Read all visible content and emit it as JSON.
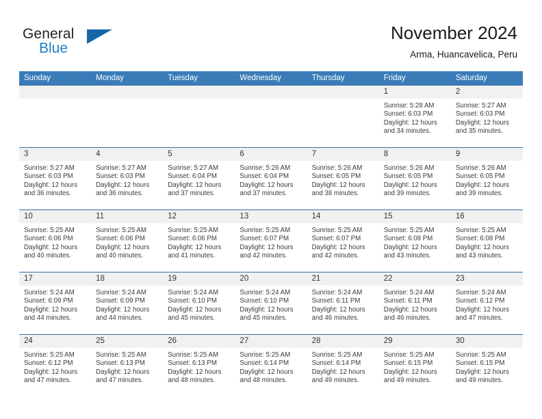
{
  "brand": {
    "name_part1": "General",
    "name_part2": "Blue",
    "flag_icon": "triangle-flag-icon"
  },
  "header": {
    "month_title": "November 2024",
    "location": "Arma, Huancavelica, Peru"
  },
  "colors": {
    "header_blue": "#3a7cb8",
    "row_border_blue": "#2f6fa8",
    "daynum_band": "#f1f1f1",
    "brand_blue": "#1f7fc4",
    "flag_blue": "#1565a8",
    "text": "#3a3a3a"
  },
  "weekday_headers": [
    "Sunday",
    "Monday",
    "Tuesday",
    "Wednesday",
    "Thursday",
    "Friday",
    "Saturday"
  ],
  "weeks": [
    [
      {
        "day": "",
        "empty": true
      },
      {
        "day": "",
        "empty": true
      },
      {
        "day": "",
        "empty": true
      },
      {
        "day": "",
        "empty": true
      },
      {
        "day": "",
        "empty": true
      },
      {
        "day": "1",
        "sunrise": "Sunrise: 5:28 AM",
        "sunset": "Sunset: 6:03 PM",
        "daylight1": "Daylight: 12 hours",
        "daylight2": "and 34 minutes."
      },
      {
        "day": "2",
        "sunrise": "Sunrise: 5:27 AM",
        "sunset": "Sunset: 6:03 PM",
        "daylight1": "Daylight: 12 hours",
        "daylight2": "and 35 minutes."
      }
    ],
    [
      {
        "day": "3",
        "sunrise": "Sunrise: 5:27 AM",
        "sunset": "Sunset: 6:03 PM",
        "daylight1": "Daylight: 12 hours",
        "daylight2": "and 36 minutes."
      },
      {
        "day": "4",
        "sunrise": "Sunrise: 5:27 AM",
        "sunset": "Sunset: 6:03 PM",
        "daylight1": "Daylight: 12 hours",
        "daylight2": "and 36 minutes."
      },
      {
        "day": "5",
        "sunrise": "Sunrise: 5:27 AM",
        "sunset": "Sunset: 6:04 PM",
        "daylight1": "Daylight: 12 hours",
        "daylight2": "and 37 minutes."
      },
      {
        "day": "6",
        "sunrise": "Sunrise: 5:26 AM",
        "sunset": "Sunset: 6:04 PM",
        "daylight1": "Daylight: 12 hours",
        "daylight2": "and 37 minutes."
      },
      {
        "day": "7",
        "sunrise": "Sunrise: 5:26 AM",
        "sunset": "Sunset: 6:05 PM",
        "daylight1": "Daylight: 12 hours",
        "daylight2": "and 38 minutes."
      },
      {
        "day": "8",
        "sunrise": "Sunrise: 5:26 AM",
        "sunset": "Sunset: 6:05 PM",
        "daylight1": "Daylight: 12 hours",
        "daylight2": "and 39 minutes."
      },
      {
        "day": "9",
        "sunrise": "Sunrise: 5:26 AM",
        "sunset": "Sunset: 6:05 PM",
        "daylight1": "Daylight: 12 hours",
        "daylight2": "and 39 minutes."
      }
    ],
    [
      {
        "day": "10",
        "sunrise": "Sunrise: 5:25 AM",
        "sunset": "Sunset: 6:06 PM",
        "daylight1": "Daylight: 12 hours",
        "daylight2": "and 40 minutes."
      },
      {
        "day": "11",
        "sunrise": "Sunrise: 5:25 AM",
        "sunset": "Sunset: 6:06 PM",
        "daylight1": "Daylight: 12 hours",
        "daylight2": "and 40 minutes."
      },
      {
        "day": "12",
        "sunrise": "Sunrise: 5:25 AM",
        "sunset": "Sunset: 6:06 PM",
        "daylight1": "Daylight: 12 hours",
        "daylight2": "and 41 minutes."
      },
      {
        "day": "13",
        "sunrise": "Sunrise: 5:25 AM",
        "sunset": "Sunset: 6:07 PM",
        "daylight1": "Daylight: 12 hours",
        "daylight2": "and 42 minutes."
      },
      {
        "day": "14",
        "sunrise": "Sunrise: 5:25 AM",
        "sunset": "Sunset: 6:07 PM",
        "daylight1": "Daylight: 12 hours",
        "daylight2": "and 42 minutes."
      },
      {
        "day": "15",
        "sunrise": "Sunrise: 5:25 AM",
        "sunset": "Sunset: 6:08 PM",
        "daylight1": "Daylight: 12 hours",
        "daylight2": "and 43 minutes."
      },
      {
        "day": "16",
        "sunrise": "Sunrise: 5:25 AM",
        "sunset": "Sunset: 6:08 PM",
        "daylight1": "Daylight: 12 hours",
        "daylight2": "and 43 minutes."
      }
    ],
    [
      {
        "day": "17",
        "sunrise": "Sunrise: 5:24 AM",
        "sunset": "Sunset: 6:09 PM",
        "daylight1": "Daylight: 12 hours",
        "daylight2": "and 44 minutes."
      },
      {
        "day": "18",
        "sunrise": "Sunrise: 5:24 AM",
        "sunset": "Sunset: 6:09 PM",
        "daylight1": "Daylight: 12 hours",
        "daylight2": "and 44 minutes."
      },
      {
        "day": "19",
        "sunrise": "Sunrise: 5:24 AM",
        "sunset": "Sunset: 6:10 PM",
        "daylight1": "Daylight: 12 hours",
        "daylight2": "and 45 minutes."
      },
      {
        "day": "20",
        "sunrise": "Sunrise: 5:24 AM",
        "sunset": "Sunset: 6:10 PM",
        "daylight1": "Daylight: 12 hours",
        "daylight2": "and 45 minutes."
      },
      {
        "day": "21",
        "sunrise": "Sunrise: 5:24 AM",
        "sunset": "Sunset: 6:11 PM",
        "daylight1": "Daylight: 12 hours",
        "daylight2": "and 46 minutes."
      },
      {
        "day": "22",
        "sunrise": "Sunrise: 5:24 AM",
        "sunset": "Sunset: 6:11 PM",
        "daylight1": "Daylight: 12 hours",
        "daylight2": "and 46 minutes."
      },
      {
        "day": "23",
        "sunrise": "Sunrise: 5:24 AM",
        "sunset": "Sunset: 6:12 PM",
        "daylight1": "Daylight: 12 hours",
        "daylight2": "and 47 minutes."
      }
    ],
    [
      {
        "day": "24",
        "sunrise": "Sunrise: 5:25 AM",
        "sunset": "Sunset: 6:12 PM",
        "daylight1": "Daylight: 12 hours",
        "daylight2": "and 47 minutes."
      },
      {
        "day": "25",
        "sunrise": "Sunrise: 5:25 AM",
        "sunset": "Sunset: 6:13 PM",
        "daylight1": "Daylight: 12 hours",
        "daylight2": "and 47 minutes."
      },
      {
        "day": "26",
        "sunrise": "Sunrise: 5:25 AM",
        "sunset": "Sunset: 6:13 PM",
        "daylight1": "Daylight: 12 hours",
        "daylight2": "and 48 minutes."
      },
      {
        "day": "27",
        "sunrise": "Sunrise: 5:25 AM",
        "sunset": "Sunset: 6:14 PM",
        "daylight1": "Daylight: 12 hours",
        "daylight2": "and 48 minutes."
      },
      {
        "day": "28",
        "sunrise": "Sunrise: 5:25 AM",
        "sunset": "Sunset: 6:14 PM",
        "daylight1": "Daylight: 12 hours",
        "daylight2": "and 49 minutes."
      },
      {
        "day": "29",
        "sunrise": "Sunrise: 5:25 AM",
        "sunset": "Sunset: 6:15 PM",
        "daylight1": "Daylight: 12 hours",
        "daylight2": "and 49 minutes."
      },
      {
        "day": "30",
        "sunrise": "Sunrise: 5:25 AM",
        "sunset": "Sunset: 6:15 PM",
        "daylight1": "Daylight: 12 hours",
        "daylight2": "and 49 minutes."
      }
    ]
  ]
}
